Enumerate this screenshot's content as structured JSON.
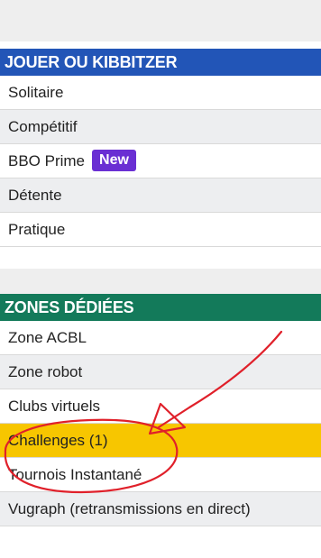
{
  "section_play": {
    "title": "JOUER OU KIBBITZER",
    "items": [
      {
        "label": "Solitaire"
      },
      {
        "label": "Compétitif"
      },
      {
        "label": "BBO Prime",
        "badge": "New"
      },
      {
        "label": "Détente"
      },
      {
        "label": "Pratique"
      }
    ]
  },
  "section_zones": {
    "title": "ZONES DÉDIÉES",
    "items": [
      {
        "label": "Zone ACBL"
      },
      {
        "label": "Zone robot"
      },
      {
        "label": "Clubs virtuels"
      },
      {
        "label": "Challenges (1)"
      },
      {
        "label": "Tournois Instantané"
      },
      {
        "label": "Vugraph (retransmissions en direct)"
      }
    ]
  },
  "colors": {
    "section_play_header": "#2255b7",
    "section_zones_header": "#137a5a",
    "highlight_row": "#f7c600",
    "new_badge": "#6a2fd3",
    "annotation": "#e0202a"
  }
}
